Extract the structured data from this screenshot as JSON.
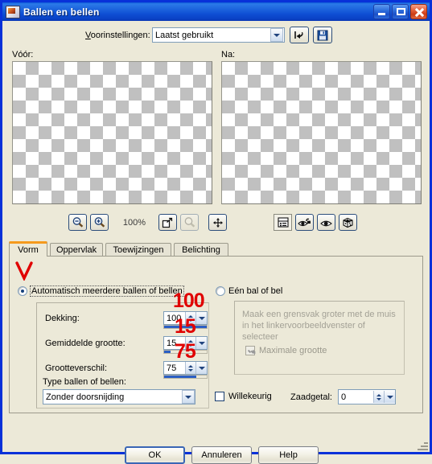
{
  "window": {
    "title": "Ballen en bellen",
    "icon": "image-document-icon",
    "caption_buttons": [
      {
        "name": "minimize-button",
        "label": "Minimaliseren"
      },
      {
        "name": "maximize-button",
        "label": "Maximaliseren"
      },
      {
        "name": "close-button",
        "label": "Sluiten"
      }
    ]
  },
  "presets": {
    "label": "Voorinstellingen:",
    "value": "Laatst gebruikt",
    "reset_icon": "reset-arrow-icon",
    "save_icon": "save-disk-icon"
  },
  "preview": {
    "before_label": "Vóór:",
    "after_label": "Na:",
    "zoom_level": "100%",
    "left_tools": [
      {
        "name": "zoom-out-button",
        "icon": "magnifier-minus-icon",
        "enabled": true
      },
      {
        "name": "zoom-in-button",
        "icon": "magnifier-plus-icon",
        "enabled": true
      },
      {
        "name": "fit-image-button",
        "icon": "fit-to-window-icon",
        "enabled": true
      },
      {
        "name": "zoom-selection-button",
        "icon": "magnifier-selection-icon",
        "enabled": false
      },
      {
        "name": "pan-button",
        "icon": "pan-move-icon",
        "enabled": true
      }
    ],
    "right_tools": [
      {
        "name": "split-view-button",
        "icon": "split-panes-icon",
        "enabled": true,
        "pressed": true
      },
      {
        "name": "auto-proof-button",
        "icon": "eye-lock-icon",
        "enabled": true
      },
      {
        "name": "proof-button",
        "icon": "eye-icon",
        "enabled": true
      },
      {
        "name": "randomize-button",
        "icon": "dice-icon",
        "enabled": true
      }
    ]
  },
  "tabs": [
    {
      "label": "Vorm",
      "active": true
    },
    {
      "label": "Oppervlak",
      "active": false
    },
    {
      "label": "Toewijzingen",
      "active": false
    },
    {
      "label": "Belichting",
      "active": false
    }
  ],
  "shape_tab": {
    "mode_auto": {
      "label": "Automatisch meerdere ballen of bellen",
      "selected": true
    },
    "mode_single": {
      "label": "Eén bal of bel",
      "selected": false
    },
    "fields": [
      {
        "name": "opacity",
        "label": "Dekking:",
        "value": "100",
        "fill_percent": 100
      },
      {
        "name": "average-size",
        "label": "Gemiddelde grootte:",
        "value": "15",
        "fill_percent": 15
      },
      {
        "name": "size-variance",
        "label": "Grootteverschil:",
        "value": "75",
        "fill_percent": 75
      }
    ],
    "type_label": "Type ballen of bellen:",
    "type_value": "Zonder doorsnijding",
    "random_checkbox": {
      "label": "Willekeurig",
      "checked": false
    },
    "seed_label": "Zaadgetal:",
    "seed_value": "0",
    "single_hint": "Maak een grensvak groter met de muis in het linkervoorbeeldvenster of selecteer",
    "max_size_checkbox": {
      "label": "Maximale grootte",
      "checked": true,
      "enabled": false
    }
  },
  "buttons": {
    "ok": "OK",
    "cancel": "Annuleren",
    "help": "Help"
  },
  "annotations": {
    "opacity": "100",
    "average_size": "15",
    "size_variance": "75",
    "check_mark": "V",
    "color": "#e00000"
  }
}
